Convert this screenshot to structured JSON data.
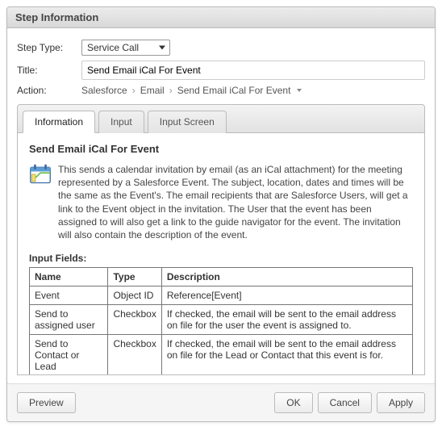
{
  "panel": {
    "title": "Step Information"
  },
  "form": {
    "stepTypeLabel": "Step Type:",
    "stepTypeValue": "Service Call",
    "titleLabel": "Title:",
    "titleValue": "Send Email iCal For Event",
    "actionLabel": "Action:",
    "breadcrumb": [
      "Salesforce",
      "Email",
      "Send Email iCal For Event"
    ]
  },
  "tabs": {
    "items": [
      {
        "label": "Information",
        "active": true
      },
      {
        "label": "Input",
        "active": false
      },
      {
        "label": "Input Screen",
        "active": false
      }
    ]
  },
  "info": {
    "heading": "Send Email iCal For Event",
    "description": "This sends a calendar invitation by email (as an iCal attachment) for the meeting represented by a Salesforce Event. The subject, location, dates and times will be the same as the Event's. The email recipients that are Salesforce Users, will get a link to the Event object in the invitation. The User that the event has been assigned to will also get a link to the guide navigator for the event. The invitation will also contain the description of the event.",
    "inputFieldsLabel": "Input Fields:",
    "columns": {
      "name": "Name",
      "type": "Type",
      "description": "Description"
    },
    "rows": [
      {
        "name": "Event",
        "type": "Object ID",
        "description": "Reference[Event]"
      },
      {
        "name": "Send to assigned user",
        "type": "Checkbox",
        "description": "If checked, the email will be sent to the email address on file for the user the event is assigned to."
      },
      {
        "name": "Send to Contact or Lead",
        "type": "Checkbox",
        "description": "If checked, the email will be sent to the email address on file for the Lead or Contact that this event is for."
      }
    ]
  },
  "buttons": {
    "preview": "Preview",
    "ok": "OK",
    "cancel": "Cancel",
    "apply": "Apply"
  }
}
